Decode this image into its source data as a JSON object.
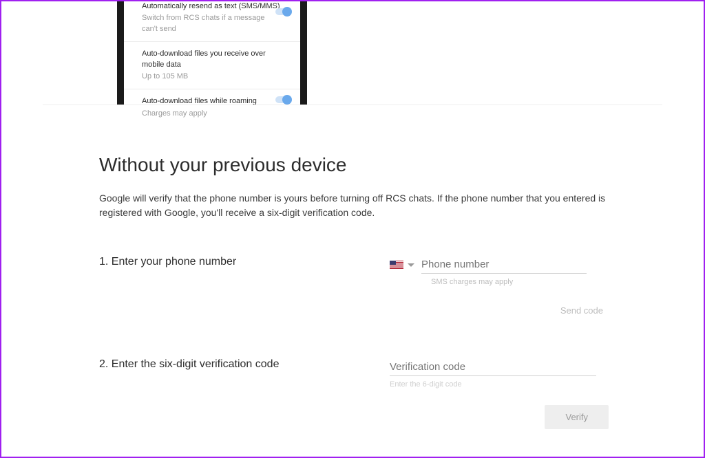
{
  "phone_settings": [
    {
      "title": "Automatically resend as text (SMS/MMS)",
      "sub": "Switch from RCS chats if a message can't send",
      "toggle": true
    },
    {
      "title": "Auto-download files you receive over mobile data",
      "sub": "Up to 105 MB",
      "toggle": false
    },
    {
      "title": "Auto-download files while roaming",
      "sub": "Charges may apply",
      "toggle": true
    }
  ],
  "heading": "Without your previous device",
  "lead": "Google will verify that the phone number is yours before turning off RCS chats. If the phone number that you entered is registered with Google, you'll receive a six-digit verification code.",
  "step1_label": "1. Enter your phone number",
  "phone_placeholder": "Phone number",
  "phone_helper": "SMS charges may apply",
  "send_code": "Send code",
  "step2_label": "2. Enter the six-digit verification code",
  "code_placeholder": "Verification code",
  "code_helper": "Enter the 6-digit code",
  "verify": "Verify"
}
